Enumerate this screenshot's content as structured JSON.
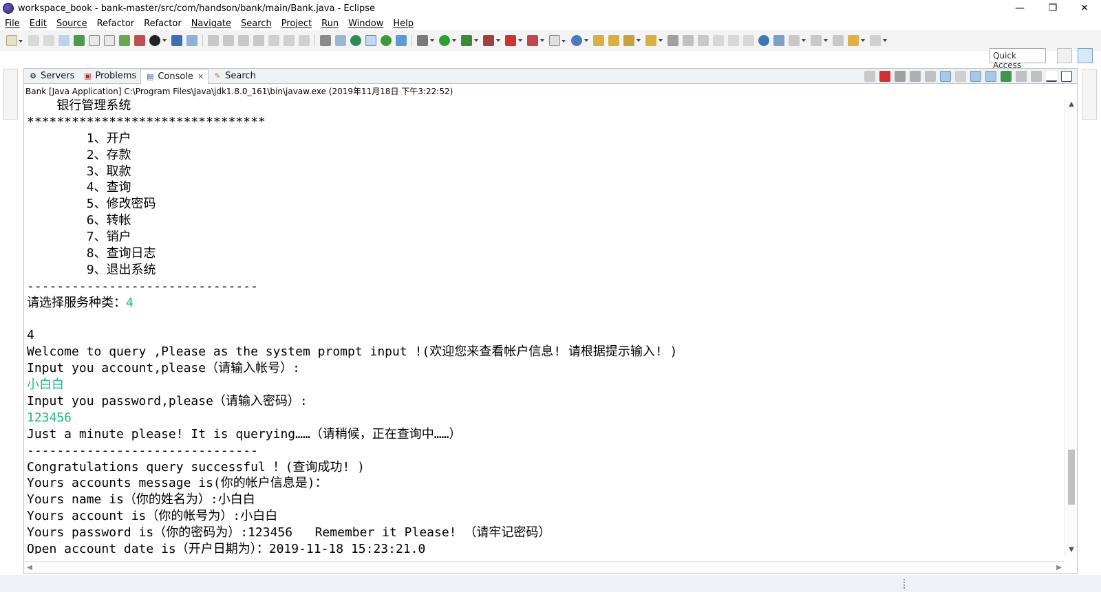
{
  "window": {
    "title": "workspace_book - bank-master/src/com/handson/bank/main/Bank.java - Eclipse",
    "minimize": "—",
    "restore": "❐",
    "close": "✕"
  },
  "menu": [
    "File",
    "Edit",
    "Source",
    "Refactor",
    "Refactor",
    "Navigate",
    "Search",
    "Project",
    "Run",
    "Window",
    "Help"
  ],
  "quick_access": {
    "placeholder": "Quick Access"
  },
  "tabs": [
    {
      "label": "Servers",
      "icon": "servers-icon"
    },
    {
      "label": "Problems",
      "icon": "problems-icon"
    },
    {
      "label": "Console",
      "icon": "console-icon",
      "active": true,
      "close": "✕"
    },
    {
      "label": "Search",
      "icon": "search-icon"
    }
  ],
  "console": {
    "description": "Bank [Java Application] C:\\Program Files\\Java\\jdk1.8.0_161\\bin\\javaw.exe (2019年11月18日 下午3:22:52)",
    "lines": [
      {
        "text": "    银行管理系统",
        "kind": "out"
      },
      {
        "text": "********************************",
        "kind": "out"
      },
      {
        "text": "        1、开户",
        "kind": "out"
      },
      {
        "text": "        2、存款",
        "kind": "out"
      },
      {
        "text": "        3、取款",
        "kind": "out"
      },
      {
        "text": "        4、查询",
        "kind": "out"
      },
      {
        "text": "        5、修改密码",
        "kind": "out"
      },
      {
        "text": "        6、转帐",
        "kind": "out"
      },
      {
        "text": "        7、销户",
        "kind": "out"
      },
      {
        "text": "        8、查询日志",
        "kind": "out"
      },
      {
        "text": "        9、退出系统",
        "kind": "out"
      },
      {
        "text": "-------------------------------",
        "kind": "out"
      },
      {
        "text": "请选择服务种类：",
        "kind": "out",
        "input": "4"
      },
      {
        "text": "",
        "kind": "out"
      },
      {
        "text": "4",
        "kind": "out"
      },
      {
        "text": "Welcome to query ,Please as the system prompt input !(欢迎您来查看帐户信息! 请根据提示输入! )",
        "kind": "out"
      },
      {
        "text": "Input you account,please（请输入帐号）:",
        "kind": "out"
      },
      {
        "text": "小白白",
        "kind": "in"
      },
      {
        "text": "Input you password,please（请输入密码）:",
        "kind": "out"
      },
      {
        "text": "123456",
        "kind": "in"
      },
      {
        "text": "Just a minute please! It is querying……（请稍候，正在查询中……）",
        "kind": "out"
      },
      {
        "text": "-------------------------------",
        "kind": "out"
      },
      {
        "text": "Congratulations query successful ！(查询成功! )",
        "kind": "out"
      },
      {
        "text": "Yours accounts message is(你的帐户信息是)：",
        "kind": "out"
      },
      {
        "text": "Yours name is（你的姓名为）:小白白",
        "kind": "out"
      },
      {
        "text": "Yours account is（你的帐号为）:小白白",
        "kind": "out"
      },
      {
        "text": "Yours password is（你的密码为）:123456   Remember it Please! （请牢记密码）",
        "kind": "out"
      },
      {
        "text": "Open account date is（开户日期为）：2019-11-18 15:23:21.0",
        "kind": "out"
      }
    ]
  },
  "colors": {
    "input_text": "#18b888",
    "tab_bar": "#eef1f6"
  }
}
